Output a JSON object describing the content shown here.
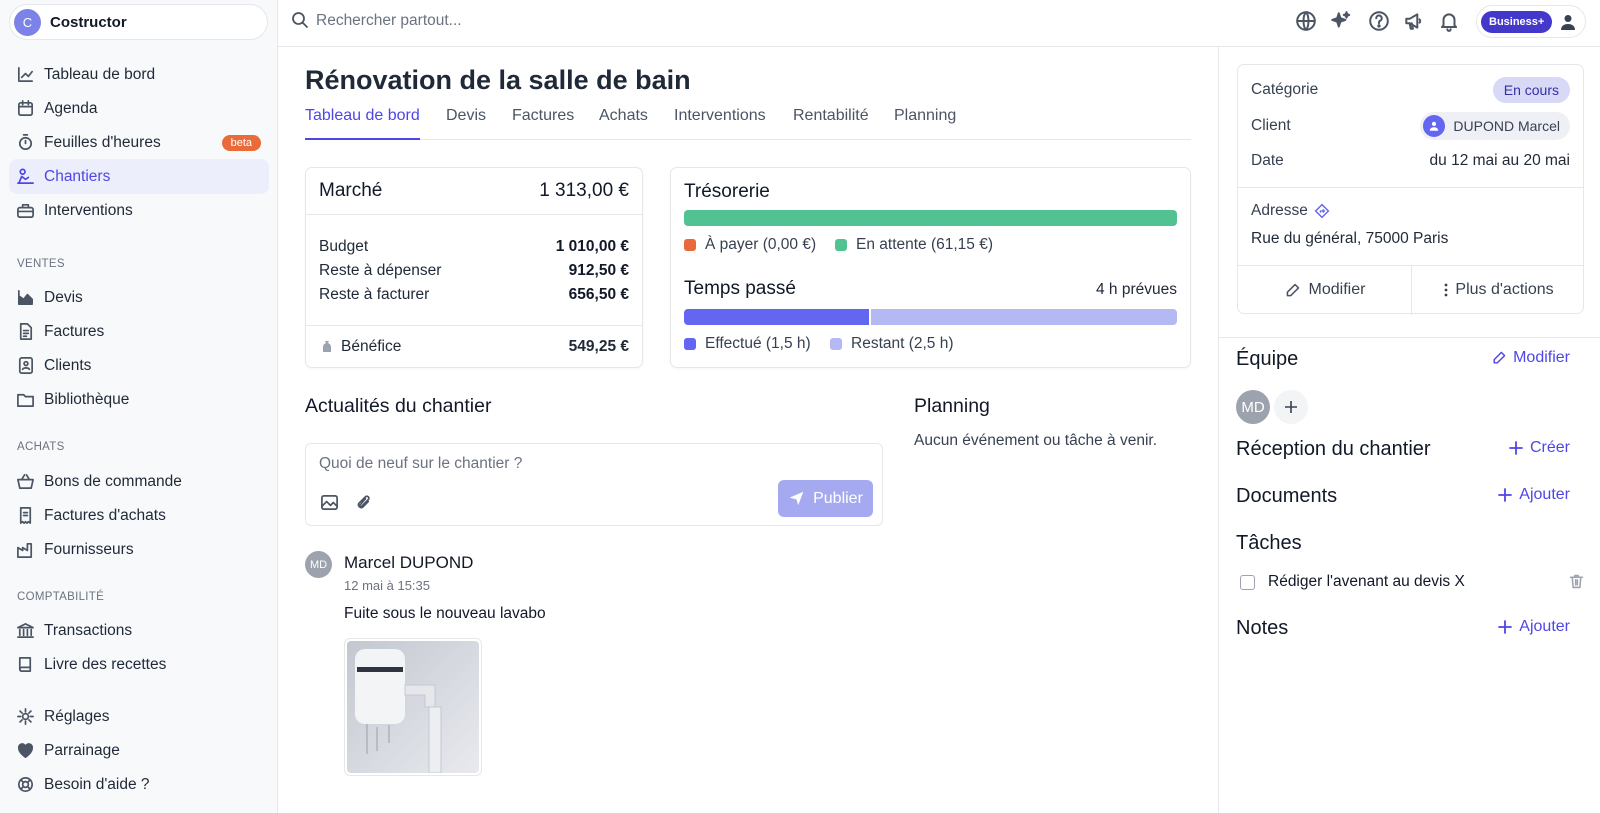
{
  "workspace": {
    "initial": "C",
    "name": "Costructor"
  },
  "nav": {
    "main": [
      {
        "label": "Tableau de bord",
        "icon": "chart-line-icon"
      },
      {
        "label": "Agenda",
        "icon": "calendar-icon"
      },
      {
        "label": "Feuilles d'heures",
        "icon": "stopwatch-icon",
        "badge": "beta"
      },
      {
        "label": "Chantiers",
        "icon": "worker-icon",
        "active": true
      },
      {
        "label": "Interventions",
        "icon": "toolbox-icon"
      }
    ],
    "ventes_title": "VENTES",
    "ventes": [
      {
        "label": "Devis",
        "icon": "chart-area-icon"
      },
      {
        "label": "Factures",
        "icon": "file-invoice-icon"
      },
      {
        "label": "Clients",
        "icon": "contact-book-icon"
      },
      {
        "label": "Bibliothèque",
        "icon": "folder-icon"
      }
    ],
    "achats_title": "ACHATS",
    "achats": [
      {
        "label": "Bons de commande",
        "icon": "basket-icon"
      },
      {
        "label": "Factures d'achats",
        "icon": "receipt-icon"
      },
      {
        "label": "Fournisseurs",
        "icon": "factory-icon"
      }
    ],
    "compta_title": "COMPTABILITÉ",
    "compta": [
      {
        "label": "Transactions",
        "icon": "bank-icon"
      },
      {
        "label": "Livre des recettes",
        "icon": "book-icon"
      }
    ],
    "bottom": [
      {
        "label": "Réglages",
        "icon": "gear-icon"
      },
      {
        "label": "Parrainage",
        "icon": "heart-icon"
      },
      {
        "label": "Besoin d'aide ?",
        "icon": "lifebuoy-icon"
      }
    ]
  },
  "topbar": {
    "search_placeholder": "Rechercher partout...",
    "plan_badge": "Business+"
  },
  "page": {
    "title": "Rénovation de la salle de bain",
    "tabs": [
      "Tableau de bord",
      "Devis",
      "Factures",
      "Achats",
      "Interventions",
      "Rentabilité",
      "Planning"
    ]
  },
  "marche": {
    "title": "Marché",
    "total": "1 313,00 €",
    "rows": [
      {
        "label": "Budget",
        "value": "1 010,00 €"
      },
      {
        "label": "Reste à dépenser",
        "value": "912,50 €"
      },
      {
        "label": "Reste à facturer",
        "value": "656,50 €"
      }
    ],
    "benefice_label": "Bénéfice",
    "benefice_value": "549,25 €"
  },
  "tresorerie": {
    "title": "Trésorerie",
    "paid_fraction": 1.0,
    "legend_payer": "À payer (0,00 €)",
    "legend_attente": "En attente (61,15 €)",
    "color_payer": "#e8693d",
    "color_attente": "#52c293"
  },
  "temps": {
    "title": "Temps passé",
    "prevues": "4 h prévues",
    "done_hours": 1.5,
    "total_hours": 4,
    "legend_done": "Effectué (1,5 h)",
    "legend_rest": "Restant (2,5 h)",
    "color_done": "#6366f1",
    "color_rest": "#b4b8f3"
  },
  "actualites": {
    "title": "Actualités du chantier",
    "placeholder": "Quoi de neuf sur le chantier ?",
    "publish": "Publier",
    "post": {
      "initials": "MD",
      "author": "Marcel DUPOND",
      "time": "12 mai à 15:35",
      "text": "Fuite sous le nouveau lavabo"
    }
  },
  "planning": {
    "title": "Planning",
    "empty": "Aucun événement ou tâche à venir."
  },
  "info": {
    "categorie_label": "Catégorie",
    "categorie_value": "En cours",
    "client_label": "Client",
    "client_value": "DUPOND Marcel",
    "date_label": "Date",
    "date_value": "du 12 mai au 20 mai",
    "adresse_label": "Adresse",
    "adresse_value": "Rue du général, 75000 Paris",
    "modifier": "Modifier",
    "plus": "Plus d'actions"
  },
  "equipe": {
    "title": "Équipe",
    "action": "Modifier",
    "member_initials": "MD"
  },
  "reception": {
    "title": "Réception du chantier",
    "action": "Créer"
  },
  "documents": {
    "title": "Documents",
    "action": "Ajouter"
  },
  "taches": {
    "title": "Tâches",
    "items": [
      {
        "label": "Rédiger l'avenant au devis X",
        "done": false
      }
    ]
  },
  "notes": {
    "title": "Notes",
    "action": "Ajouter"
  }
}
